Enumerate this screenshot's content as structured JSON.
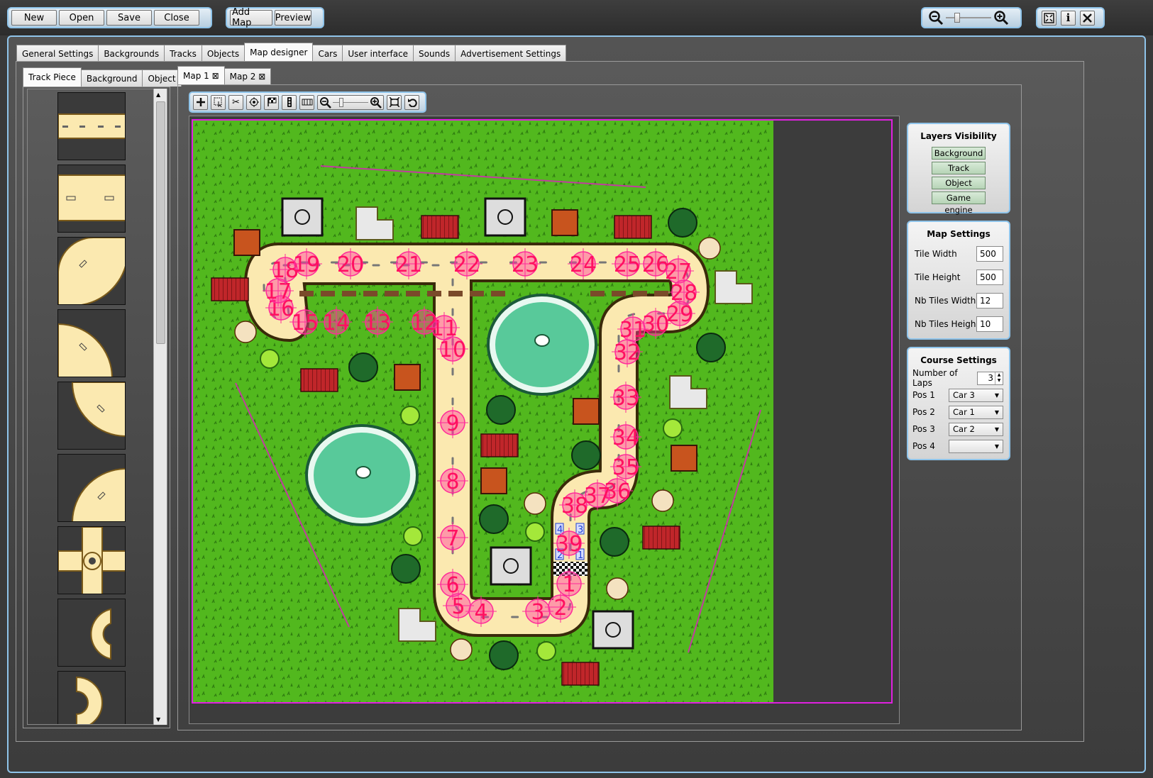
{
  "toolbar": {
    "new": "New",
    "open": "Open",
    "save": "Save",
    "close": "Close",
    "add_map": "Add Map",
    "preview": "Preview"
  },
  "main_tabs": [
    "General Settings",
    "Backgrounds",
    "Tracks",
    "Objects",
    "Map designer",
    "Cars",
    "User interface",
    "Sounds",
    "Advertisement Settings"
  ],
  "active_main_tab": "Map designer",
  "left_tabs": [
    "Track Piece",
    "Background",
    "Object"
  ],
  "map_tabs": [
    {
      "label": "Map 1"
    },
    {
      "label": "Map 2"
    }
  ],
  "layers": {
    "title": "Layers Visibility",
    "items": [
      "Background",
      "Track",
      "Object",
      "Game engine"
    ]
  },
  "map_settings": {
    "title": "Map Settings",
    "fields": [
      {
        "label": "Tile Width",
        "value": "500"
      },
      {
        "label": "Tile Height",
        "value": "500"
      },
      {
        "label": "Nb Tiles Width",
        "value": "12"
      },
      {
        "label": "Nb Tiles Heigh",
        "value": "10"
      }
    ]
  },
  "course": {
    "title": "Course Settings",
    "laps_label": "Number of Laps",
    "laps_value": "3",
    "positions": [
      {
        "label": "Pos 1",
        "value": "Car 3"
      },
      {
        "label": "Pos 2",
        "value": "Car 1"
      },
      {
        "label": "Pos 3",
        "value": "Car 2"
      },
      {
        "label": "Pos 4",
        "value": ""
      }
    ]
  },
  "checkpoints": [
    "1",
    "2",
    "3",
    "4",
    "5",
    "6",
    "7",
    "8",
    "9",
    "10",
    "11",
    "12",
    "13",
    "14",
    "15",
    "16",
    "17",
    "18",
    "19",
    "20",
    "21",
    "22",
    "23",
    "24",
    "25",
    "26",
    "27",
    "28",
    "29",
    "30",
    "31",
    "32",
    "33",
    "34",
    "35",
    "36",
    "37",
    "38",
    "39"
  ],
  "grid_slots": [
    "1",
    "2",
    "3",
    "4"
  ],
  "colors": {
    "accent_border": "#8fc4ea",
    "checkpoint": "#ff1060",
    "grass": "#52b81e",
    "road": "#fbe9b0",
    "frame": "#e020e0"
  },
  "icons": [
    "zoom-out-icon",
    "zoom-in-icon",
    "fullscreen-icon",
    "info-icon",
    "close-icon",
    "add-icon",
    "select-icon",
    "scissors-icon",
    "target-icon",
    "flag-icon",
    "traffic-light-icon",
    "grid-icon",
    "fit-icon",
    "undo-icon"
  ]
}
